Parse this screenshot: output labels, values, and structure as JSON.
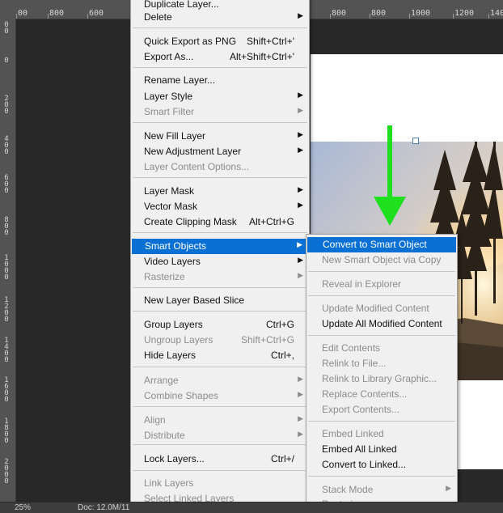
{
  "ruler": {
    "top_labels_left": [
      "00",
      "800",
      "600"
    ],
    "top_labels_right": [
      "800",
      "600",
      "800",
      "1000",
      "1200",
      "1400"
    ],
    "left_labels": [
      "0 0",
      "0",
      "2 0 0",
      "4 0 0",
      "6 0 0",
      "8 0 0",
      "1 0 0 0",
      "1 2 0 0",
      "1 4 0 0",
      "1 6 0 0",
      "1 8 0 0",
      "2 0 0 0"
    ]
  },
  "status": {
    "zoom": "25%",
    "doc_info": "Doc: 12.0M/11"
  },
  "main_menu": {
    "items": [
      {
        "label": "Duplicate Layer...",
        "shortcut": "",
        "submenu": false,
        "disabled": false
      },
      {
        "label": "Delete",
        "shortcut": "",
        "submenu": true,
        "disabled": false
      },
      {
        "label": "Quick Export as PNG",
        "shortcut": "Shift+Ctrl+'",
        "submenu": false,
        "disabled": false
      },
      {
        "label": "Export As...",
        "shortcut": "Alt+Shift+Ctrl+'",
        "submenu": false,
        "disabled": false
      },
      {
        "label": "Rename Layer...",
        "shortcut": "",
        "submenu": false,
        "disabled": false
      },
      {
        "label": "Layer Style",
        "shortcut": "",
        "submenu": true,
        "disabled": false
      },
      {
        "label": "Smart Filter",
        "shortcut": "",
        "submenu": true,
        "disabled": true
      },
      {
        "label": "New Fill Layer",
        "shortcut": "",
        "submenu": true,
        "disabled": false
      },
      {
        "label": "New Adjustment Layer",
        "shortcut": "",
        "submenu": true,
        "disabled": false
      },
      {
        "label": "Layer Content Options...",
        "shortcut": "",
        "submenu": false,
        "disabled": true
      },
      {
        "label": "Layer Mask",
        "shortcut": "",
        "submenu": true,
        "disabled": false
      },
      {
        "label": "Vector Mask",
        "shortcut": "",
        "submenu": true,
        "disabled": false
      },
      {
        "label": "Create Clipping Mask",
        "shortcut": "Alt+Ctrl+G",
        "submenu": false,
        "disabled": false
      },
      {
        "label": "Smart Objects",
        "shortcut": "",
        "submenu": true,
        "disabled": false
      },
      {
        "label": "Video Layers",
        "shortcut": "",
        "submenu": true,
        "disabled": false
      },
      {
        "label": "Rasterize",
        "shortcut": "",
        "submenu": true,
        "disabled": true
      },
      {
        "label": "New Layer Based Slice",
        "shortcut": "",
        "submenu": false,
        "disabled": false
      },
      {
        "label": "Group Layers",
        "shortcut": "Ctrl+G",
        "submenu": false,
        "disabled": false
      },
      {
        "label": "Ungroup Layers",
        "shortcut": "Shift+Ctrl+G",
        "submenu": false,
        "disabled": true
      },
      {
        "label": "Hide Layers",
        "shortcut": "Ctrl+,",
        "submenu": false,
        "disabled": false
      },
      {
        "label": "Arrange",
        "shortcut": "",
        "submenu": true,
        "disabled": true
      },
      {
        "label": "Combine Shapes",
        "shortcut": "",
        "submenu": true,
        "disabled": true
      },
      {
        "label": "Align",
        "shortcut": "",
        "submenu": true,
        "disabled": true
      },
      {
        "label": "Distribute",
        "shortcut": "",
        "submenu": true,
        "disabled": true
      },
      {
        "label": "Lock Layers...",
        "shortcut": "Ctrl+/",
        "submenu": false,
        "disabled": false
      },
      {
        "label": "Link Layers",
        "shortcut": "",
        "submenu": false,
        "disabled": true
      },
      {
        "label": "Select Linked Layers",
        "shortcut": "",
        "submenu": false,
        "disabled": true
      }
    ]
  },
  "sub_menu": {
    "items": [
      {
        "label": "Convert to Smart Object",
        "submenu": false,
        "disabled": false
      },
      {
        "label": "New Smart Object via Copy",
        "submenu": false,
        "disabled": true
      },
      {
        "label": "Reveal in Explorer",
        "submenu": false,
        "disabled": true
      },
      {
        "label": "Update Modified Content",
        "submenu": false,
        "disabled": true
      },
      {
        "label": "Update All Modified Content",
        "submenu": false,
        "disabled": false
      },
      {
        "label": "Edit Contents",
        "submenu": false,
        "disabled": true
      },
      {
        "label": "Relink to File...",
        "submenu": false,
        "disabled": true
      },
      {
        "label": "Relink to Library Graphic...",
        "submenu": false,
        "disabled": true
      },
      {
        "label": "Replace Contents...",
        "submenu": false,
        "disabled": true
      },
      {
        "label": "Export Contents...",
        "submenu": false,
        "disabled": true
      },
      {
        "label": "Embed Linked",
        "submenu": false,
        "disabled": true
      },
      {
        "label": "Embed All Linked",
        "submenu": false,
        "disabled": false
      },
      {
        "label": "Convert to Linked...",
        "submenu": false,
        "disabled": false
      },
      {
        "label": "Stack Mode",
        "submenu": true,
        "disabled": true
      },
      {
        "label": "Rasterize",
        "submenu": false,
        "disabled": true
      }
    ]
  },
  "highlight": {
    "main_item": "Smart Objects",
    "sub_item": "Convert to Smart Object",
    "accent": "#0a70d3",
    "arrow_color": "#1ee01e"
  }
}
